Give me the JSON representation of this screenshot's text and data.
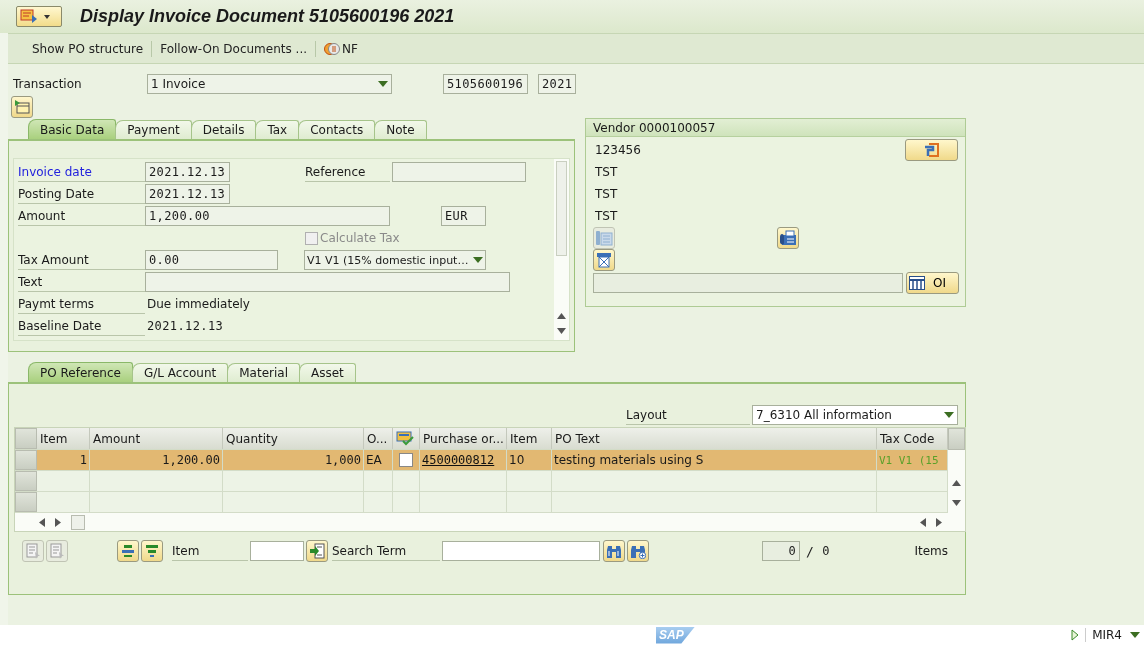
{
  "window": {
    "title": "Display Invoice Document 5105600196 2021"
  },
  "toolbar": {
    "items": [
      {
        "kind": "text",
        "label": "Show PO structure"
      },
      {
        "kind": "text",
        "label": "Follow-On Documents ..."
      },
      {
        "kind": "icon",
        "label": "NF"
      }
    ]
  },
  "header": {
    "transaction_label": "Transaction",
    "transaction": "1 Invoice",
    "document_number": "5105600196",
    "fiscal_year": "2021"
  },
  "header_tabs": [
    {
      "label": "Basic Data",
      "selected": true
    },
    {
      "label": "Payment",
      "selected": false
    },
    {
      "label": "Details",
      "selected": false
    },
    {
      "label": "Tax",
      "selected": false
    },
    {
      "label": "Contacts",
      "selected": false
    },
    {
      "label": "Note",
      "selected": false
    }
  ],
  "basic_data": {
    "invoice_date_label": "Invoice date",
    "invoice_date": "2021.12.13",
    "reference_label": "Reference",
    "posting_date_label": "Posting Date",
    "posting_date": "2021.12.13",
    "amount_label": "Amount",
    "amount": "1,200.00",
    "currency": "EUR",
    "calculate_tax": {
      "label": "Calculate Tax",
      "checked": false,
      "disabled": true
    },
    "tax_amount_label": "Tax Amount",
    "tax_amount": "0.00",
    "tax_code": "V1 V1 (15% domestic input…",
    "text_label": "Text",
    "payment_terms_label": "Paymt terms",
    "payment_terms": "Due immediately",
    "baseline_date_label": "Baseline Date",
    "baseline_date": "2021.12.13"
  },
  "vendor": {
    "title": "Vendor 0000100057",
    "lines": [
      "123456",
      "TST",
      "TST",
      "TST"
    ],
    "oi_button": "OI"
  },
  "item_tabs": [
    {
      "label": "PO Reference",
      "selected": true
    },
    {
      "label": "G/L Account",
      "selected": false
    },
    {
      "label": "Material",
      "selected": false
    },
    {
      "label": "Asset",
      "selected": false
    }
  ],
  "layout": {
    "label": "Layout",
    "value": "7_6310 All information"
  },
  "table": {
    "columns": [
      {
        "kind": "number",
        "label": "Item"
      },
      {
        "kind": "number",
        "label": "Amount"
      },
      {
        "kind": "number",
        "label": "Quantity"
      },
      {
        "kind": "text",
        "label": "O..."
      },
      {
        "kind": "checkbox"
      },
      {
        "kind": "link",
        "label": "Purchase or..."
      },
      {
        "kind": "text",
        "label": "Item"
      },
      {
        "kind": "text",
        "label": "PO Text"
      },
      {
        "kind": "code",
        "label": "Tax Code"
      }
    ],
    "rows": [
      {
        "selected": true,
        "cells": [
          "1",
          "1,200.00",
          "1,000",
          "EA",
          {
            "checked": false
          },
          "4500000812",
          "10",
          "testing materials using S",
          "V1 V1 (15"
        ]
      }
    ]
  },
  "item_search": {
    "item_label": "Item",
    "search_label": "Search Term",
    "count": "0",
    "separator": "/",
    "total": "0",
    "items_label": "Items"
  },
  "status_bar": {
    "logo": "SAP",
    "transaction": "MIR4"
  }
}
